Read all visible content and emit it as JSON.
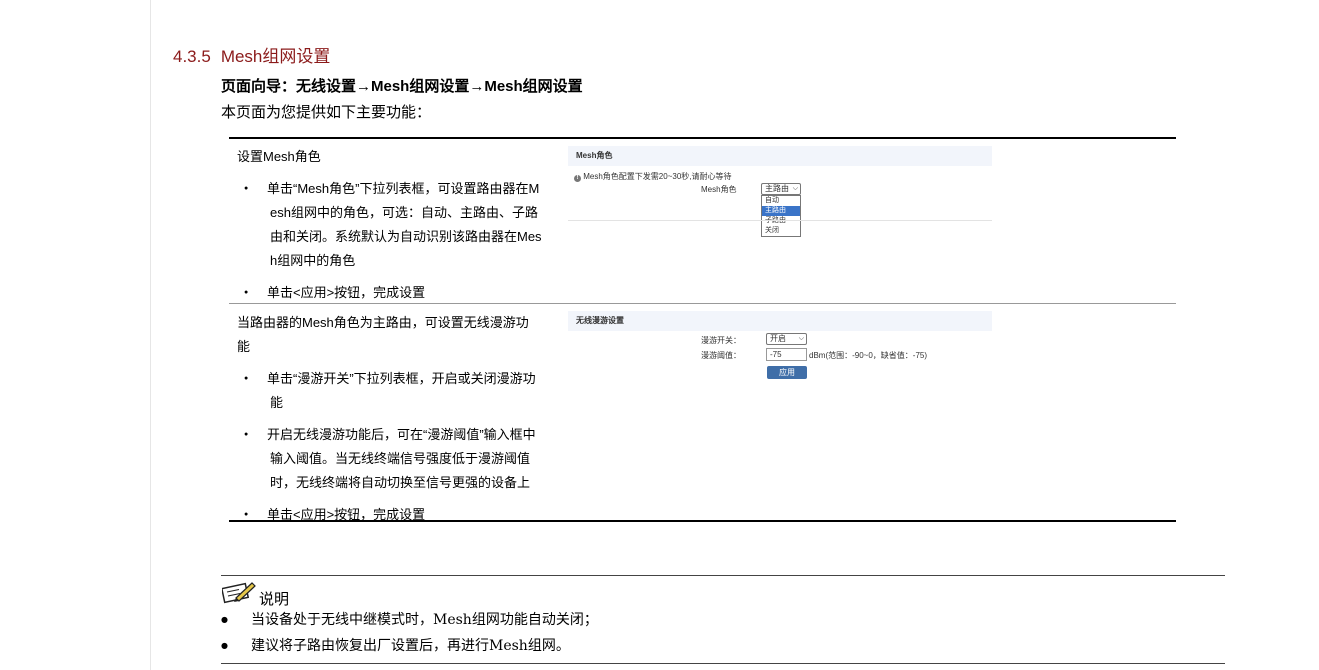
{
  "section": {
    "number": "4.3.5",
    "title": "Mesh组网设置"
  },
  "nav": "页面向导：无线设置→Mesh组网设置→Mesh组网设置",
  "intro": "本页面为您提供如下主要功能：",
  "row1": {
    "head": "设置Mesh角色",
    "bullets": [
      [
        "单击“Mesh角色”下拉列表框，可设置路由器在M",
        "esh组网中的角色，可选：自动、主路由、子路",
        "由和关闭。系统默认为自动识别该路由器在Mes",
        "h组网中的角色"
      ],
      [
        "单击<应用>按钮，完成设置"
      ]
    ],
    "panel": {
      "header": "Mesh角色",
      "info_icon": "info-icon",
      "info_text": "Mesh角色配置下发需20~30秒,请耐心等待",
      "field_label": "Mesh角色",
      "select_value": "主路由",
      "options": [
        "自动",
        "主路由",
        "子路由",
        "关闭"
      ]
    }
  },
  "row2": {
    "head": [
      "当路由器的Mesh角色为主路由，可设置无线漫游功",
      "能"
    ],
    "bullets": [
      [
        "单击“漫游开关”下拉列表框，开启或关闭漫游功",
        "能"
      ],
      [
        "开启无线漫游功能后，可在“漫游阈值”输入框中",
        "输入阈值。当无线终端信号强度低于漫游阈值",
        "时，无线终端将自动切换至信号更强的设备上"
      ],
      [
        "单击<应用>按钮，完成设置"
      ]
    ],
    "panel": {
      "header": "无线漫游设置",
      "switch_label": "漫游开关：",
      "switch_value": "开启",
      "threshold_label": "漫游阈值：",
      "threshold_value": "-75",
      "threshold_hint": "dBm(范围：-90~0，缺省值：-75)",
      "apply_label": "应用"
    }
  },
  "note": {
    "icon": "note-pencil-icon",
    "title": "说明",
    "items": [
      "当设备处于无线中继模式时，Mesh组网功能自动关闭；",
      "建议将子路由恢复出厂设置后，再进行Mesh组网。"
    ]
  }
}
